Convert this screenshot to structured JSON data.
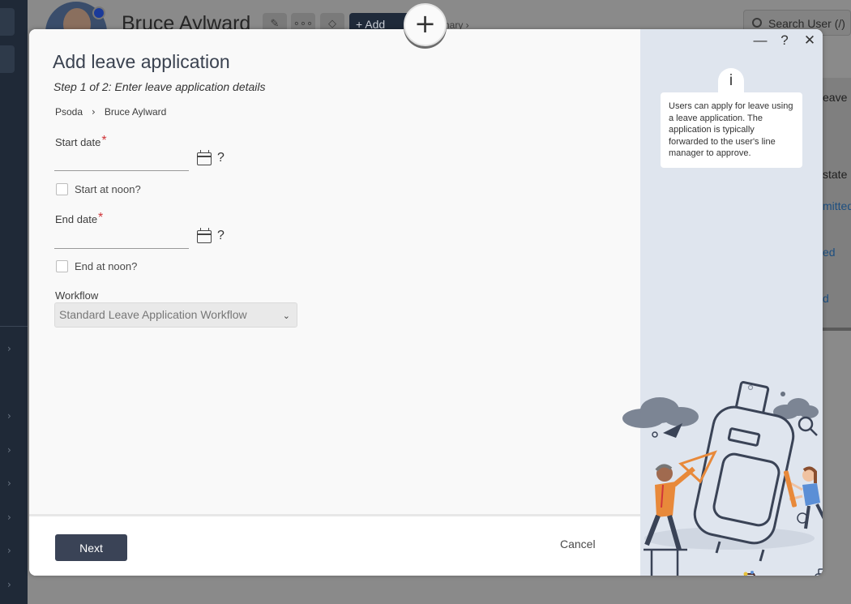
{
  "background": {
    "user_name": "Bruce Aylward",
    "add_label": "+ Add",
    "summary_crumb": "nary ›",
    "search_placeholder": "Search User (/)",
    "panel": {
      "leave": "eave",
      "state": "state",
      "r1": "mitted",
      "r2": "ed",
      "r3": "d"
    }
  },
  "modal": {
    "title": "Add leave application",
    "subtitle": "Step 1 of 2: Enter leave application details",
    "breadcrumb": [
      "Psoda",
      "Bruce Aylward"
    ],
    "fields": {
      "start_date": {
        "label": "Start date",
        "required": "*",
        "value": "",
        "help": "?"
      },
      "start_noon": {
        "label": "Start at noon?"
      },
      "end_date": {
        "label": "End date",
        "required": "*",
        "value": "",
        "help": "?"
      },
      "end_noon": {
        "label": "End at noon?"
      },
      "workflow": {
        "label": "Workflow",
        "selected": "Standard Leave Application Workflow"
      }
    },
    "footer": {
      "next_label": "Next",
      "cancel_label": "Cancel"
    },
    "window_controls": {
      "minimize": "—",
      "help": "?",
      "close": "✕"
    },
    "info": {
      "icon_glyph": "i",
      "text": "Users can apply for leave using a leave application. The application is typically forwarded to the user's line manager to approve."
    }
  },
  "float_plus": "+",
  "colors": {
    "primary_button": "#3a4356",
    "required": "#d0363a",
    "side_panel": "#dfe5ee",
    "illustration_orange": "#e8893a",
    "illustration_navy": "#3a4356",
    "illustration_blue": "#5b8fd6"
  }
}
